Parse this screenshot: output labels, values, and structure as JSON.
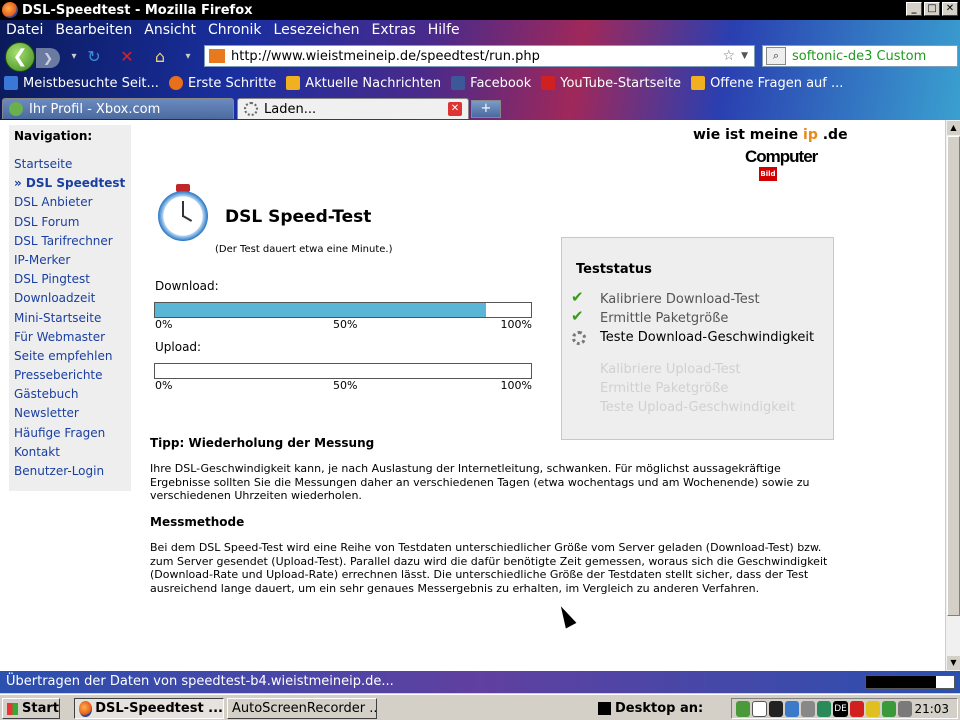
{
  "window": {
    "title": "DSL-Speedtest - Mozilla Firefox",
    "controls": [
      "_",
      "□",
      "✕"
    ]
  },
  "menu": [
    "Datei",
    "Bearbeiten",
    "Ansicht",
    "Chronik",
    "Lesezeichen",
    "Extras",
    "Hilfe"
  ],
  "navbar": {
    "url": "http://www.wieistmeineip.de/speedtest/run.php",
    "search": "softonic-de3 Custom"
  },
  "bookmarks": [
    {
      "label": "Meistbesuchte Seit...",
      "color": "#3a78d8"
    },
    {
      "label": "Erste Schritte",
      "color": "#e8701a"
    },
    {
      "label": "Aktuelle Nachrichten",
      "color": "#f0b020"
    },
    {
      "label": "Facebook",
      "color": "#3b5998"
    },
    {
      "label": "YouTube-Startseite",
      "color": "#d02020"
    },
    {
      "label": "Offene Fragen auf ...",
      "color": "#f0b020"
    }
  ],
  "tabs": [
    {
      "label": "Ihr Profil - Xbox.com",
      "active": false
    },
    {
      "label": "Laden...",
      "active": true
    }
  ],
  "newtab_label": "+",
  "sidebar": {
    "title": "Navigation:",
    "items": [
      {
        "label": "Startseite",
        "active": false
      },
      {
        "label": "» DSL Speedtest",
        "active": true
      },
      {
        "label": "DSL Anbieter",
        "active": false
      },
      {
        "label": "DSL Forum",
        "active": false
      },
      {
        "label": "DSL Tarifrechner",
        "active": false
      },
      {
        "label": "IP-Merker",
        "active": false
      },
      {
        "label": "DSL Pingtest",
        "active": false
      },
      {
        "label": "Downloadzeit",
        "active": false
      },
      {
        "label": "Mini-Startseite",
        "active": false
      },
      {
        "label": "Für Webmaster",
        "active": false
      },
      {
        "label": "Seite empfehlen",
        "active": false
      },
      {
        "label": "Presseberichte",
        "active": false
      },
      {
        "label": "Gästebuch",
        "active": false
      },
      {
        "label": "Newsletter",
        "active": false
      },
      {
        "label": "Häufige Fragen",
        "active": false
      },
      {
        "label": "Kontakt",
        "active": false
      },
      {
        "label": "Benutzer-Login",
        "active": false
      }
    ]
  },
  "logo": {
    "line1_a": "wie ist meine ",
    "line1_ip": "ip",
    "line1_b": " .de",
    "line2": "Computer",
    "badge": "Bild"
  },
  "speedtest": {
    "title": "DSL Speed-Test",
    "note": "(Der Test dauert etwa eine Minute.)",
    "download_label": "Download:",
    "download_progress": 0.88,
    "upload_label": "Upload:",
    "upload_progress": 0,
    "scale": [
      "0%",
      "50%",
      "100%"
    ]
  },
  "status": {
    "title": "Teststatus",
    "items": [
      {
        "label": "Kalibriere Download-Test",
        "state": "done"
      },
      {
        "label": "Ermittle Paketgröße",
        "state": "done"
      },
      {
        "label": "Teste Download-Geschwindigkeit",
        "state": "active"
      },
      {
        "label": "Kalibriere Upload-Test",
        "state": "pending"
      },
      {
        "label": "Ermittle Paketgröße",
        "state": "pending"
      },
      {
        "label": "Teste Upload-Geschwindigkeit",
        "state": "pending"
      }
    ]
  },
  "tip": {
    "heading": "Tipp: Wiederholung der Messung",
    "text": "Ihre DSL-Geschwindigkeit kann, je nach Auslastung der Internetleitung, schwanken. Für möglichst aussagekräftige Ergebnisse sollten Sie die Messungen daher an verschiedenen Tagen (etwa wochentags und am Wochenende) sowie zu verschiedenen Uhrzeiten wiederholen."
  },
  "method": {
    "heading": "Messmethode",
    "text": "Bei dem DSL Speed-Test wird eine Reihe von Testdaten unterschiedlicher Größe vom Server geladen (Download-Test) bzw. zum Server gesendet (Upload-Test). Parallel dazu wird die dafür benötigte Zeit gemessen, woraus sich die Geschwindigkeit (Download-Rate und Upload-Rate) errechnen lässt. Die unterschiedliche Größe der Testdaten stellt sicher, dass der Test ausreichend lange dauert, um ein sehr genaues Messergebnis zu erhalten, im Vergleich zu anderen Verfahren."
  },
  "statusbar": {
    "text": "Übertragen der Daten von speedtest-b4.wieistmeineip.de..."
  },
  "taskbar": {
    "start": "Start",
    "items": [
      "DSL-Speedtest ...",
      "AutoScreenRecorder ..."
    ],
    "desktop": "Desktop an:",
    "clock": "21:03"
  }
}
